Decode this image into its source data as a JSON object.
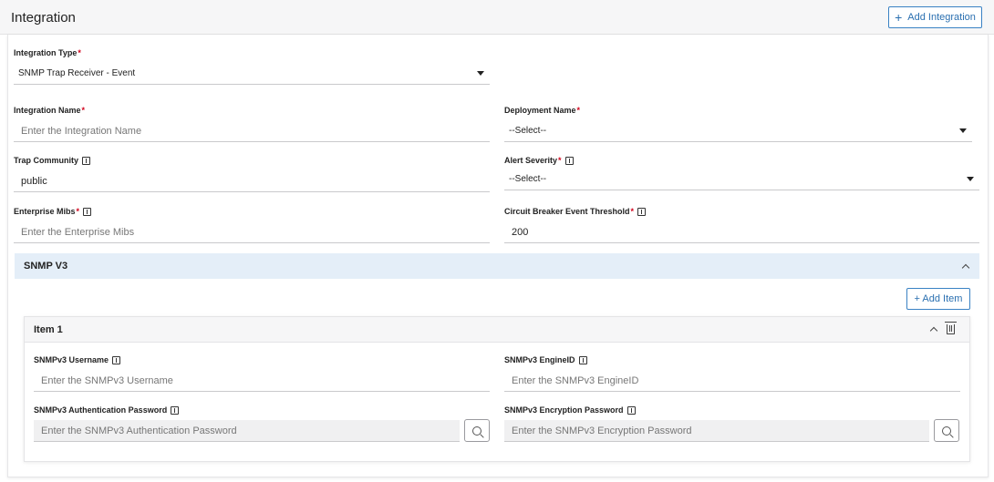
{
  "header": {
    "title": "Integration",
    "add_integration_label": "Add Integration",
    "plus_glyph": "+"
  },
  "form": {
    "required_mark": "*",
    "integration_type": {
      "label": "Integration Type",
      "value": "SNMP Trap Receiver - Event"
    },
    "integration_name": {
      "label": "Integration Name",
      "placeholder": "Enter the Integration Name"
    },
    "deployment_name": {
      "label": "Deployment Name",
      "value": "--Select--"
    },
    "trap_community": {
      "label": "Trap Community",
      "value": "public"
    },
    "alert_severity": {
      "label": "Alert Severity",
      "value": "--Select--"
    },
    "enterprise_mibs": {
      "label": "Enterprise Mibs",
      "placeholder": "Enter the Enterprise Mibs"
    },
    "circuit_breaker": {
      "label": "Circuit Breaker Event Threshold",
      "value": "200"
    }
  },
  "snmp_v3": {
    "title": "SNMP V3",
    "add_item_label": "+ Add Item",
    "items": [
      {
        "title": "Item 1",
        "username": {
          "label": "SNMPv3 Username",
          "placeholder": "Enter the SNMPv3 Username"
        },
        "engine_id": {
          "label": "SNMPv3 EngineID",
          "placeholder": "Enter the SNMPv3 EngineID"
        },
        "auth_password": {
          "label": "SNMPv3 Authentication Password",
          "placeholder": "Enter the SNMPv3 Authentication Password"
        },
        "enc_password": {
          "label": "SNMPv3 Encryption Password",
          "placeholder": "Enter the SNMPv3 Encryption Password"
        }
      }
    ]
  },
  "colors": {
    "accent": "#2a6fb0",
    "required": "#d0021b",
    "section_bg": "#e4eef8"
  },
  "icons": [
    "plus-icon",
    "chevron-down-icon",
    "info-icon",
    "chevron-up-icon",
    "trash-icon",
    "search-icon"
  ]
}
